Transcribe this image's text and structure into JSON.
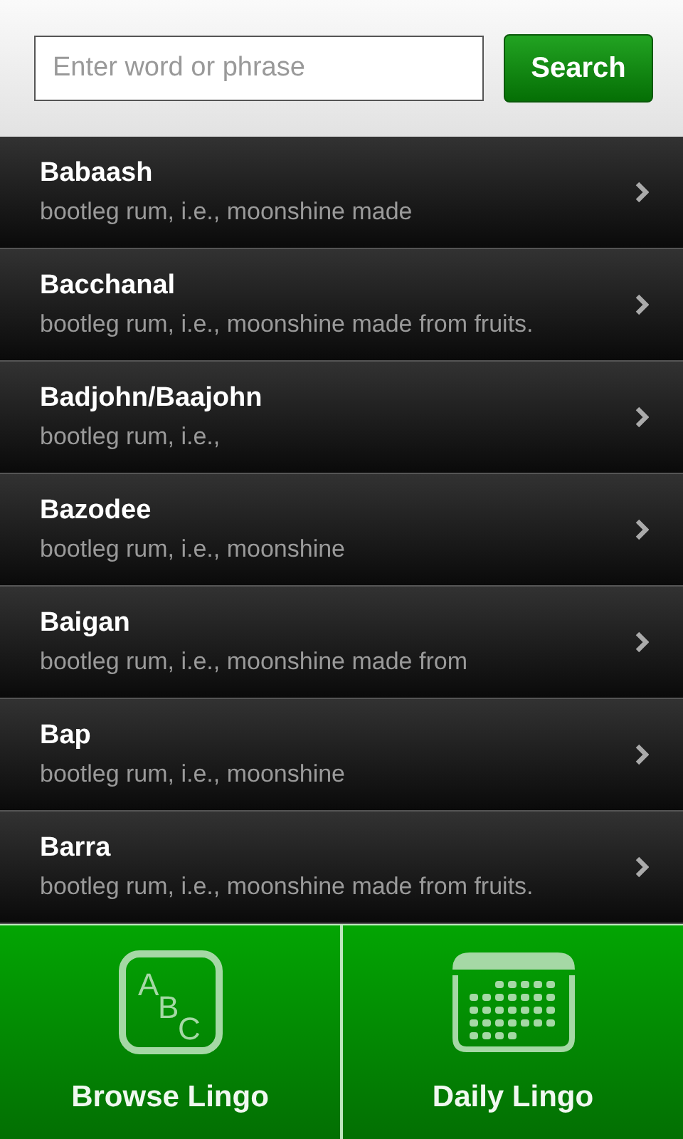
{
  "search": {
    "placeholder": "Enter word or phrase",
    "button": "Search"
  },
  "entries": [
    {
      "word": "Babaash",
      "definition": "bootleg rum, i.e., moonshine made"
    },
    {
      "word": "Bacchanal",
      "definition": "bootleg rum, i.e., moonshine made from fruits."
    },
    {
      "word": "Badjohn/Baajohn",
      "definition": "bootleg rum, i.e.,"
    },
    {
      "word": "Bazodee",
      "definition": "bootleg rum, i.e., moonshine"
    },
    {
      "word": "Baigan",
      "definition": "bootleg rum, i.e., moonshine made from"
    },
    {
      "word": "Bap",
      "definition": "bootleg rum, i.e., moonshine"
    },
    {
      "word": "Barra",
      "definition": "bootleg rum, i.e., moonshine made from fruits."
    }
  ],
  "tabs": [
    {
      "kind": "abc",
      "label": "Browse Lingo",
      "icon_letters": [
        "A",
        "B",
        "C"
      ]
    },
    {
      "kind": "calendar",
      "label": "Daily Lingo"
    }
  ]
}
